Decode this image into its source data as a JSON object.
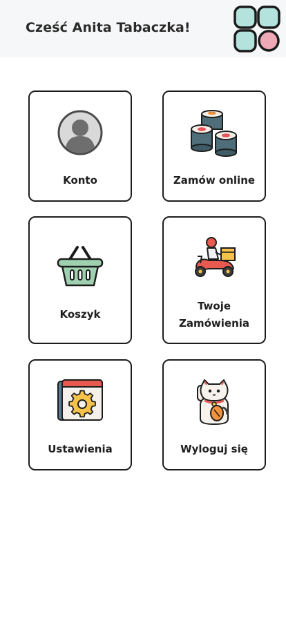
{
  "header": {
    "greeting": "Cześć Anita Tabaczka!"
  },
  "tiles": [
    {
      "label": "Konto"
    },
    {
      "label": "Zamów online"
    },
    {
      "label": "Koszyk"
    },
    {
      "label_line1": "Twoje",
      "label_line2": "Zamówienia"
    },
    {
      "label": "Ustawienia"
    },
    {
      "label": "Wyloguj się"
    }
  ],
  "colors": {
    "header_bg": "#f6f7f8",
    "tile_border": "#1c1c1c",
    "app_grid_teal": "#b4e2dc",
    "app_grid_pink": "#efa8b6"
  }
}
